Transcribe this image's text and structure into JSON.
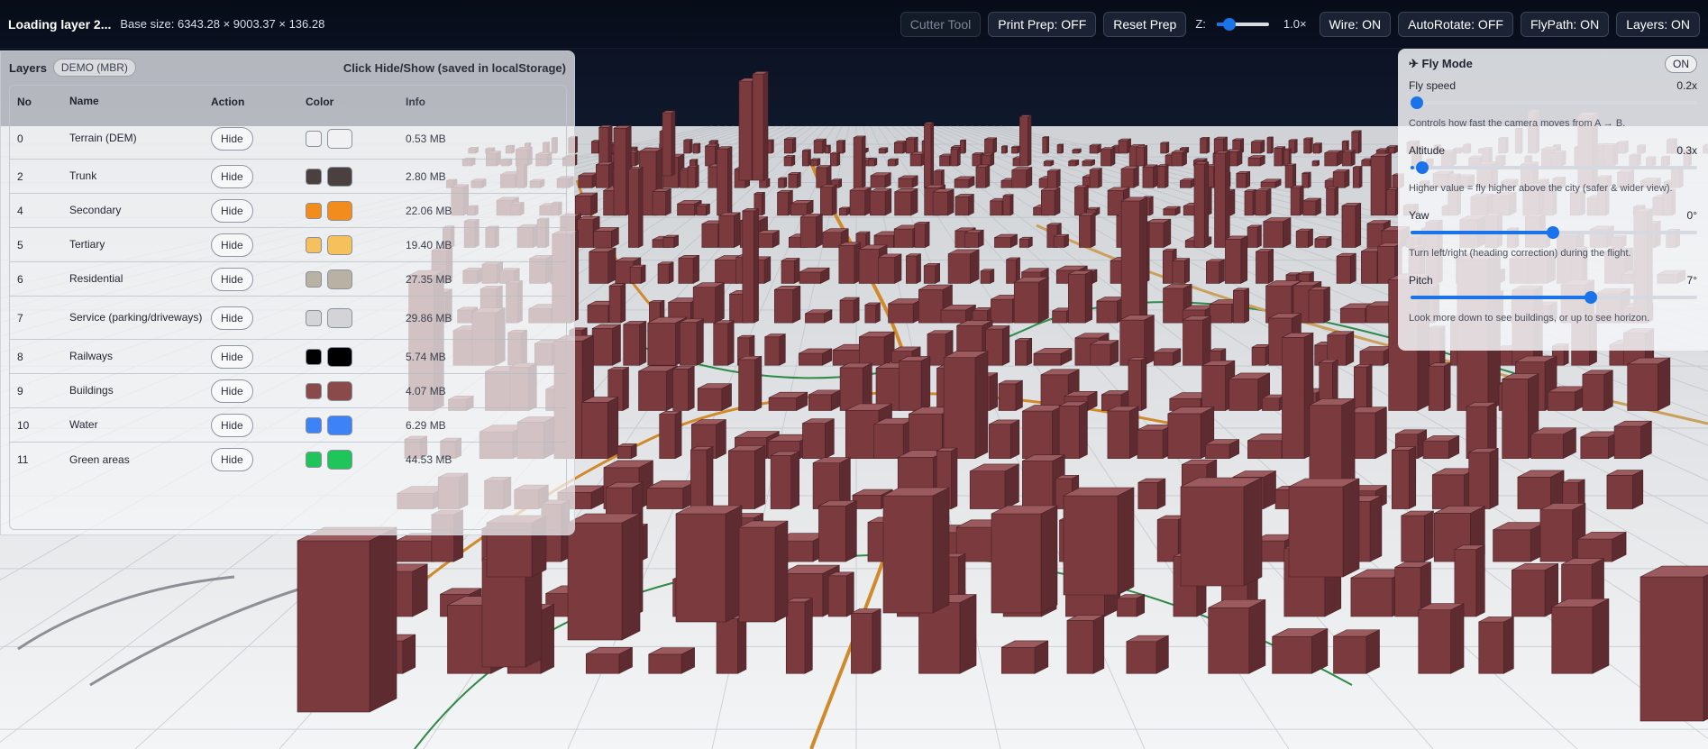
{
  "topbar": {
    "status_title": "Loading layer 2...",
    "base_size": "Base size: 6343.28 × 9003.37 × 136.28",
    "cutter_tool": "Cutter Tool",
    "print_prep": "Print Prep: OFF",
    "reset_prep": "Reset Prep",
    "z_label": "Z:",
    "z_value": "1.0×",
    "wire": "Wire: ON",
    "autorotate": "AutoRotate: OFF",
    "flypath": "FlyPath: ON",
    "layers": "Layers: ON"
  },
  "layers_panel": {
    "title": "Layers",
    "chip": "DEMO (MBR)",
    "hint": "Click Hide/Show (saved in localStorage)",
    "columns": [
      "No",
      "Name",
      "Action",
      "Color",
      "Info"
    ],
    "rows": [
      {
        "no": "0",
        "name": "Terrain (DEM)",
        "action": "Hide",
        "color": "#f1f1f3",
        "info": "0.53 MB"
      },
      {
        "no": "2",
        "name": "Trunk",
        "action": "Hide",
        "color": "#4a4040",
        "info": "2.80 MB"
      },
      {
        "no": "4",
        "name": "Secondary",
        "action": "Hide",
        "color": "#f28c1d",
        "info": "22.06 MB"
      },
      {
        "no": "5",
        "name": "Tertiary",
        "action": "Hide",
        "color": "#f5c15c",
        "info": "19.40 MB"
      },
      {
        "no": "6",
        "name": "Residential",
        "action": "Hide",
        "color": "#b9b2a4",
        "info": "27.35 MB"
      },
      {
        "no": "7",
        "name": "Service (parking/driveways)",
        "action": "Hide",
        "color": "#d4d4d6",
        "info": "29.86 MB"
      },
      {
        "no": "8",
        "name": "Railways",
        "action": "Hide",
        "color": "#000000",
        "info": "5.74 MB"
      },
      {
        "no": "9",
        "name": "Buildings",
        "action": "Hide",
        "color": "#8b4a4a",
        "info": "4.07 MB"
      },
      {
        "no": "10",
        "name": "Water",
        "action": "Hide",
        "color": "#3d82f6",
        "info": "6.29 MB"
      },
      {
        "no": "11",
        "name": "Green areas",
        "action": "Hide",
        "color": "#1fc45a",
        "info": "44.53 MB"
      }
    ]
  },
  "fly_mode": {
    "title": "✈ Fly Mode",
    "toggle": "ON",
    "sections": [
      {
        "label": "Fly speed",
        "value": "0.2x",
        "fraction": 0.0,
        "desc": "Controls how fast the camera moves from A → B."
      },
      {
        "label": "Altitude",
        "value": "0.3x",
        "fraction": 0.02,
        "desc": "Higher value = fly higher above the city (safer & wider view)."
      },
      {
        "label": "Yaw",
        "value": "0°",
        "fraction": 0.5,
        "desc": "Turn left/right (heading correction) during the flight."
      },
      {
        "label": "Pitch",
        "value": "7°",
        "fraction": 0.64,
        "desc": "Look more down to see buildings, or up to see horizon."
      }
    ]
  },
  "colors": {
    "accent": "#1a73e8",
    "building": "#7a3a3e",
    "sky": "#0b1120",
    "ground": "#e9eaec"
  }
}
